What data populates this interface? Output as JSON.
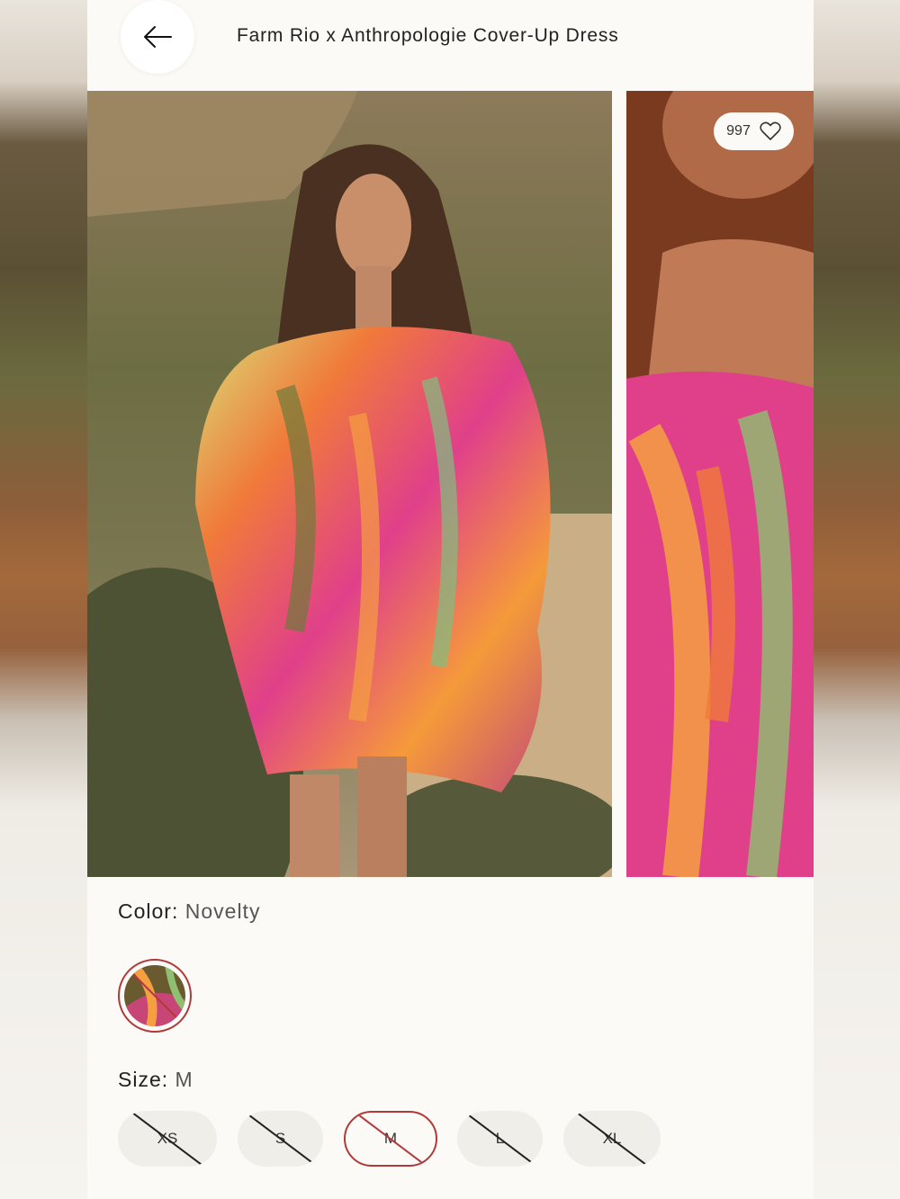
{
  "header": {
    "title": "Farm Rio x Anthropologie Cover-Up Dress",
    "back_icon": "arrow-left-icon"
  },
  "gallery": {
    "favorites_count": "997",
    "favorite_icon": "heart-outline-icon"
  },
  "color": {
    "label": "Color:",
    "value": "Novelty",
    "swatches": [
      {
        "name": "Novelty",
        "selected": true,
        "available": false
      }
    ]
  },
  "size": {
    "label": "Size:",
    "value": "M",
    "options": [
      {
        "label": "XS",
        "selected": false,
        "available": false
      },
      {
        "label": "S",
        "selected": false,
        "available": false
      },
      {
        "label": "M",
        "selected": true,
        "available": false
      },
      {
        "label": "L",
        "selected": false,
        "available": false
      },
      {
        "label": "XL",
        "selected": false,
        "available": false
      }
    ]
  },
  "colors": {
    "accent": "#b03a3a",
    "page_bg": "#fbfaf6",
    "pill_bg": "#f0eee9"
  }
}
